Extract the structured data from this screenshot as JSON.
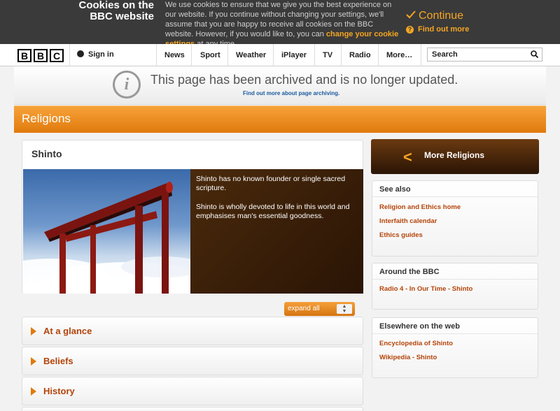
{
  "cookie": {
    "title": "Cookies on the BBC website",
    "text_part1": "We use cookies to ensure that we give you the best experience on our website. If you continue without changing your settings, we'll assume that you are happy to receive all cookies on the BBC website. However, if you would like to, you can",
    "change_link": "change your cookie settings",
    "text_part2": "at any time.",
    "continue_label": "Continue",
    "find_out_more": "Find out more"
  },
  "nav": {
    "logo": [
      "B",
      "B",
      "C"
    ],
    "sign_in": "Sign in",
    "items": [
      "News",
      "Sport",
      "Weather",
      "iPlayer",
      "TV",
      "Radio",
      "More…"
    ],
    "search_placeholder": "Search"
  },
  "archive": {
    "message": "This page has been archived and is no longer updated.",
    "link": "Find out more about page archiving."
  },
  "section": {
    "title": "Religions"
  },
  "main": {
    "title": "Shinto",
    "para1": "Shinto has no known founder or single sacred scripture.",
    "para2": "Shinto is wholly devoted to life in this world and emphasises man's essential goodness.",
    "expand_all": "expand all",
    "accordion": [
      "At a glance",
      "Beliefs",
      "History"
    ]
  },
  "sidebar": {
    "more_religions": "More Religions",
    "see_also": {
      "title": "See also",
      "links": [
        "Religion and Ethics home",
        "Interfaith calendar",
        "Ethics guides"
      ]
    },
    "around_bbc": {
      "title": "Around the BBC",
      "links": [
        "Radio 4 - In Our Time - Shinto"
      ]
    },
    "elsewhere": {
      "title": "Elsewhere on the web",
      "links": [
        "Encyclopedia of Shinto",
        "Wikipedia - Shinto"
      ]
    }
  },
  "colors": {
    "accent": "#e07a0c",
    "link": "#b4440a",
    "banner": "#3a3a3a"
  },
  "icons": [
    "check-icon",
    "question-icon",
    "user-icon",
    "search-icon",
    "info-icon",
    "chevron-left-icon",
    "triangle-right-icon"
  ]
}
